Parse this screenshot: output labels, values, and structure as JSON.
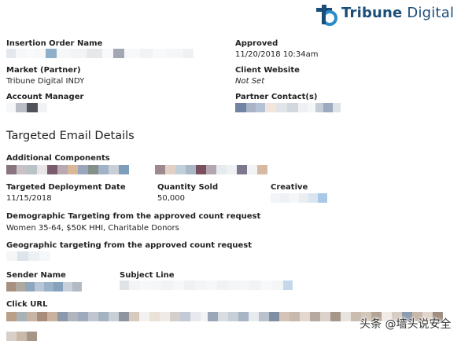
{
  "brand": {
    "bold": "Tribune",
    "regular": " Digital"
  },
  "order": {
    "insertion_order_label": "Insertion Order Name",
    "approved_label": "Approved",
    "approved_value": "11/20/2018 10:34am",
    "market_label": "Market (Partner)",
    "market_value": "Tribune Digital INDY",
    "client_website_label": "Client Website",
    "client_website_value": "Not Set",
    "account_manager_label": "Account Manager",
    "partner_contacts_label": "Partner Contact(s)"
  },
  "details": {
    "section_title": "Targeted Email Details",
    "additional_components_label": "Additional Components",
    "deployment_date_label": "Targeted Deployment Date",
    "deployment_date_value": "11/15/2018",
    "quantity_sold_label": "Quantity Sold",
    "quantity_sold_value": "50,000",
    "creative_label": "Creative",
    "demographic_label": "Demographic Targeting from the approved count request",
    "demographic_value": "Women 35-64, $50K HHI, Charitable Donors",
    "geographic_label": "Geographic targeting from the approved count request",
    "sender_name_label": "Sender Name",
    "subject_line_label": "Subject Line",
    "click_url_label": "Click URL"
  },
  "watermark": "头条 @墙头说安全",
  "colors": {
    "brand": "#1a4e79",
    "logo_accent": "#2a8bc9"
  }
}
